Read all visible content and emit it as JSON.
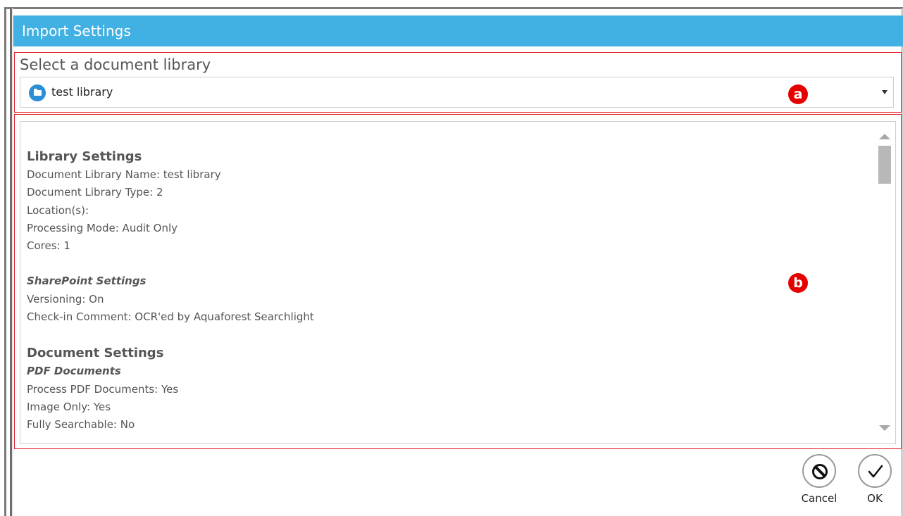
{
  "window": {
    "title": "Import Settings"
  },
  "library_selector": {
    "label": "Select a document library",
    "selected": "test library",
    "icon": "library-icon",
    "marker": "a"
  },
  "settings": {
    "marker": "b",
    "library_settings": {
      "heading": "Library Settings",
      "lines": [
        "Document Library Name: test library",
        "Document Library Type: 2",
        "Location(s):",
        "Processing Mode: Audit Only",
        "Cores: 1"
      ]
    },
    "sharepoint_settings": {
      "heading": "SharePoint Settings",
      "lines": [
        "Versioning: On",
        "Check-in Comment: OCR'ed by Aquaforest Searchlight"
      ]
    },
    "document_settings": {
      "heading": "Document Settings",
      "subheading": "PDF Documents",
      "lines": [
        "Process PDF Documents: Yes",
        "Image Only: Yes",
        "Fully Searchable: No"
      ]
    }
  },
  "actions": {
    "cancel_label": "Cancel",
    "ok_label": "OK",
    "cancel_icon": "cancel-icon",
    "ok_icon": "checkmark-icon"
  },
  "colors": {
    "titlebar": "#41b0e2",
    "annotation_border": "#e0202a",
    "marker": "#e60000",
    "library_icon": "#2a8ed8"
  }
}
